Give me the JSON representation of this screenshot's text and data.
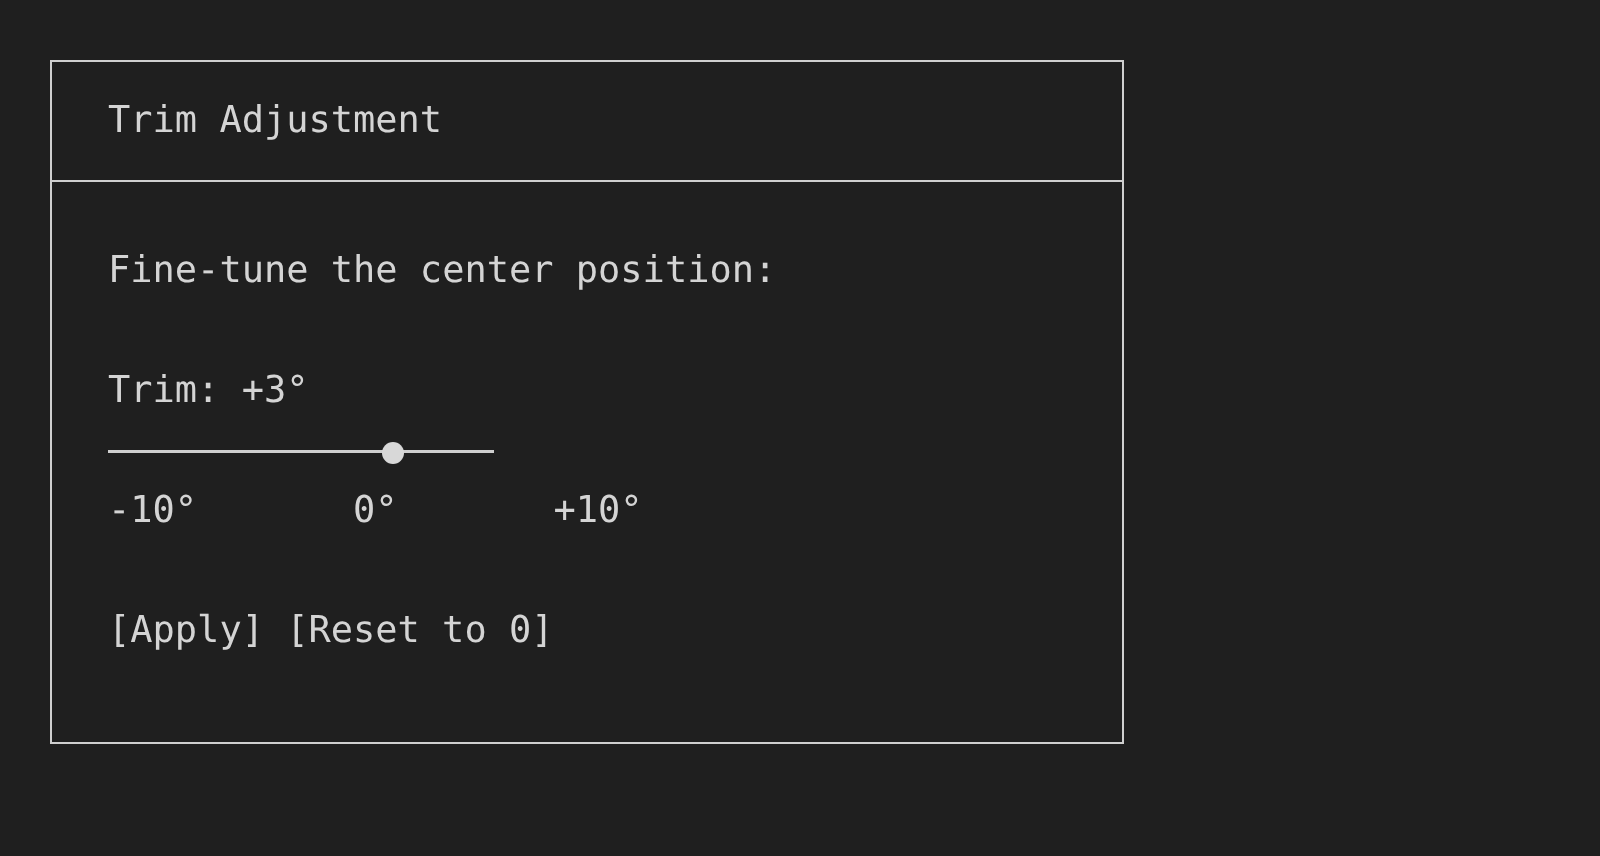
{
  "dialog": {
    "title": "Trim Adjustment",
    "prompt": "Fine-tune the center position:",
    "trim": {
      "label": "Trim: +3°",
      "level": 0.74,
      "ticks": [
        "-10°",
        "0°",
        "+10°"
      ]
    },
    "buttons": [
      "[Apply]",
      "[Reset to 0]"
    ]
  }
}
